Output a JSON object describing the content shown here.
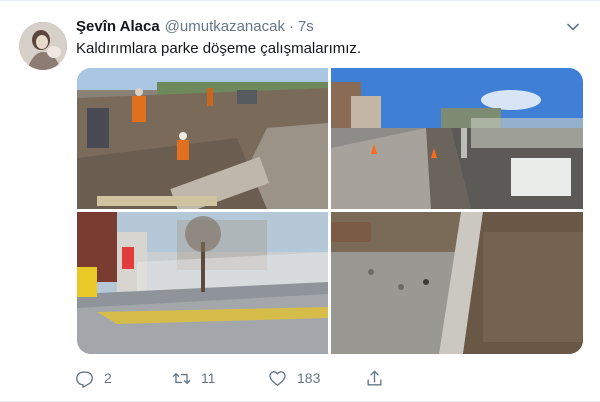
{
  "tweet": {
    "display_name": "Şevîn Alaca",
    "handle": "@umutkazanacak",
    "separator": "·",
    "time": "7s",
    "text": "Kaldırımlara parke döşeme çalışmalarımız.",
    "avatar_icon": "user-avatar",
    "menu_icon": "chevron-down-icon"
  },
  "media": {
    "photos": [
      {
        "name": "photo-workers-laying-pavers"
      },
      {
        "name": "photo-street-curb-construction"
      },
      {
        "name": "photo-finished-sidewalk-tree"
      },
      {
        "name": "photo-fresh-concrete-curb"
      }
    ]
  },
  "actions": {
    "reply": {
      "icon": "reply-icon",
      "count": "2"
    },
    "retweet": {
      "icon": "retweet-icon",
      "count": "11"
    },
    "like": {
      "icon": "heart-icon",
      "count": "183"
    },
    "share": {
      "icon": "share-icon"
    }
  },
  "colors": {
    "text_primary": "#14171a",
    "text_secondary": "#657786",
    "border": "#e6ecf0"
  }
}
